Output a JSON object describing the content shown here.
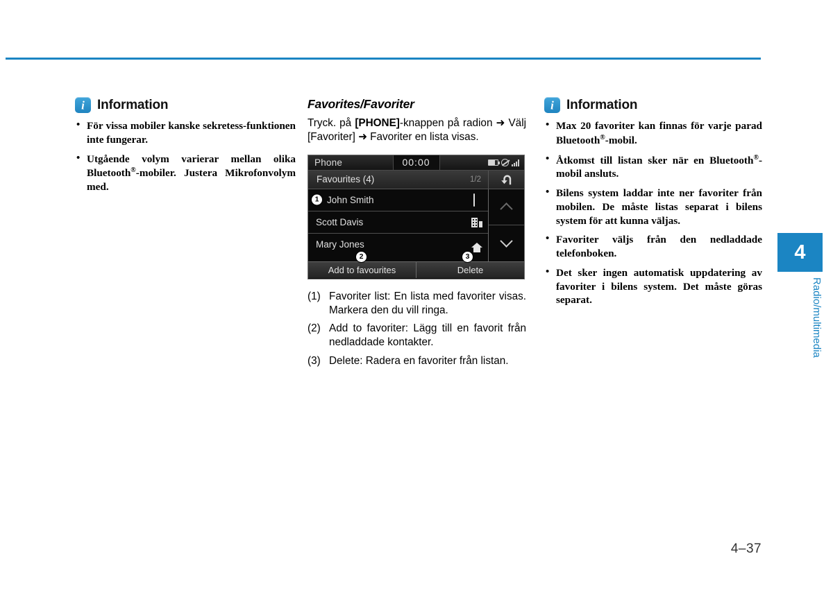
{
  "page": {
    "number": "4–37",
    "chapter_number": "4",
    "chapter_label": "Radio/multimedia",
    "accent_color": "#1b85c3"
  },
  "left_column": {
    "info_title": "Information",
    "bullets": [
      "För vissa mobiler kanske sekretess-funktionen inte fungerar.",
      "Utgående volym varierar mellan olika Bluetooth®-mobiler. Justera Mikrofonvolym med."
    ]
  },
  "middle_column": {
    "heading": "Favorites/Favoriter",
    "paragraph_part1": "Tryck. på ",
    "paragraph_bold": "[PHONE]",
    "paragraph_part2": "-knappen på radion ➜ Välj [Favoriter] ➜ Favoriter en lista visas.",
    "numbered_items": [
      {
        "marker": "(1)",
        "text": "Favoriter list: En lista med favoriter visas. Markera den du vill ringa."
      },
      {
        "marker": "(2)",
        "text": "Add to favoriter: Lägg till en favorit från nedladdade kontakter."
      },
      {
        "marker": "(3)",
        "text": "Delete: Radera en favoriter från listan."
      }
    ]
  },
  "screen": {
    "status_title": "Phone",
    "clock": "00:00",
    "status_icons": [
      "battery-icon",
      "mute-icon",
      "signal-icon"
    ],
    "subheader_title": "Favourites (4)",
    "page_indicator": "1/2",
    "back_icon": "back-arrow-icon",
    "rows": [
      {
        "badge": "1",
        "name": "John Smith",
        "icon": "mobile-phone-icon"
      },
      {
        "badge": "",
        "name": "Scott Davis",
        "icon": "office-building-icon"
      },
      {
        "badge": "",
        "name": "Mary Jones",
        "icon": "home-icon"
      }
    ],
    "scroll_up_icon": "chevron-up-icon",
    "scroll_down_icon": "chevron-down-icon",
    "buttons": [
      {
        "label": "Add to favourites",
        "badge": "2"
      },
      {
        "label": "Delete",
        "badge": "3"
      }
    ]
  },
  "right_column": {
    "info_title": "Information",
    "bullets": [
      "Max 20 favoriter kan finnas för varje parad Bluetooth®-mobil.",
      "Åtkomst till listan sker när en Bluetooth®-mobil ansluts.",
      "Bilens system laddar inte ner favoriter från mobilen. De måste listas separat i bilens system för att kunna väljas.",
      "Favoriter väljs från den nedladdade telefonboken.",
      "Det sker ingen automatisk uppdatering av favoriter i bilens system. Det måste göras separat."
    ]
  }
}
